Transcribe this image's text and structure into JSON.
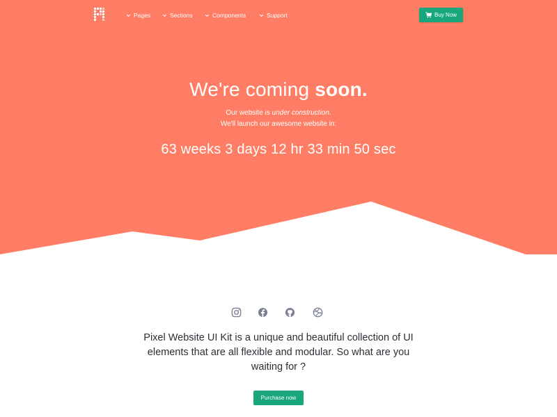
{
  "colors": {
    "hero_bg": "#ff7d64",
    "button": "#18a77a",
    "text_dark": "#2c2e35",
    "icon_gray": "#7b8094"
  },
  "nav": {
    "logo_icon": "pixel-logo-icon",
    "items": [
      {
        "label": "Pages",
        "icon": "chevron-down-icon"
      },
      {
        "label": "Sections",
        "icon": "chevron-down-icon"
      },
      {
        "label": "Components",
        "icon": "chevron-down-icon"
      },
      {
        "label": "Support",
        "icon": "chevron-down-icon"
      }
    ],
    "buy_button": {
      "label": "Buy Now",
      "icon": "cart-icon"
    }
  },
  "hero": {
    "headline_light": "We're coming ",
    "headline_bold": "soon.",
    "subtitle_prefix": "Our website is ",
    "subtitle_emphasis": "under construction.",
    "subtitle_line2": "We'll launch our awesome website in:",
    "countdown": "63 weeks 3 days 12 hr 33 min 50 sec"
  },
  "socials": [
    {
      "icon": "instagram-icon"
    },
    {
      "icon": "facebook-icon"
    },
    {
      "icon": "github-icon"
    },
    {
      "icon": "dribbble-icon"
    }
  ],
  "description": "Pixel Website UI Kit is a unique and beautiful collection of UI elements that are all flexible and modular. So what are you waiting for ?",
  "purchase_button": {
    "label": "Purchase now"
  }
}
